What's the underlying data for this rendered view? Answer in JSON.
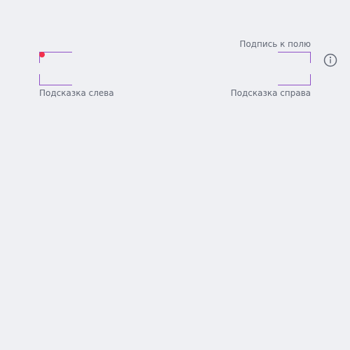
{
  "field": {
    "label": "Подпись к полю",
    "value": "",
    "required": true,
    "hint_left": "Подсказка слева",
    "hint_right": "Подсказка справа",
    "info_icon": "info-circle-icon"
  },
  "colors": {
    "background": "#eff0f3",
    "accent_outline": "#8e4ec6",
    "required_dot": "#f2304d",
    "text_secondary": "#616774",
    "icon": "#616774"
  }
}
